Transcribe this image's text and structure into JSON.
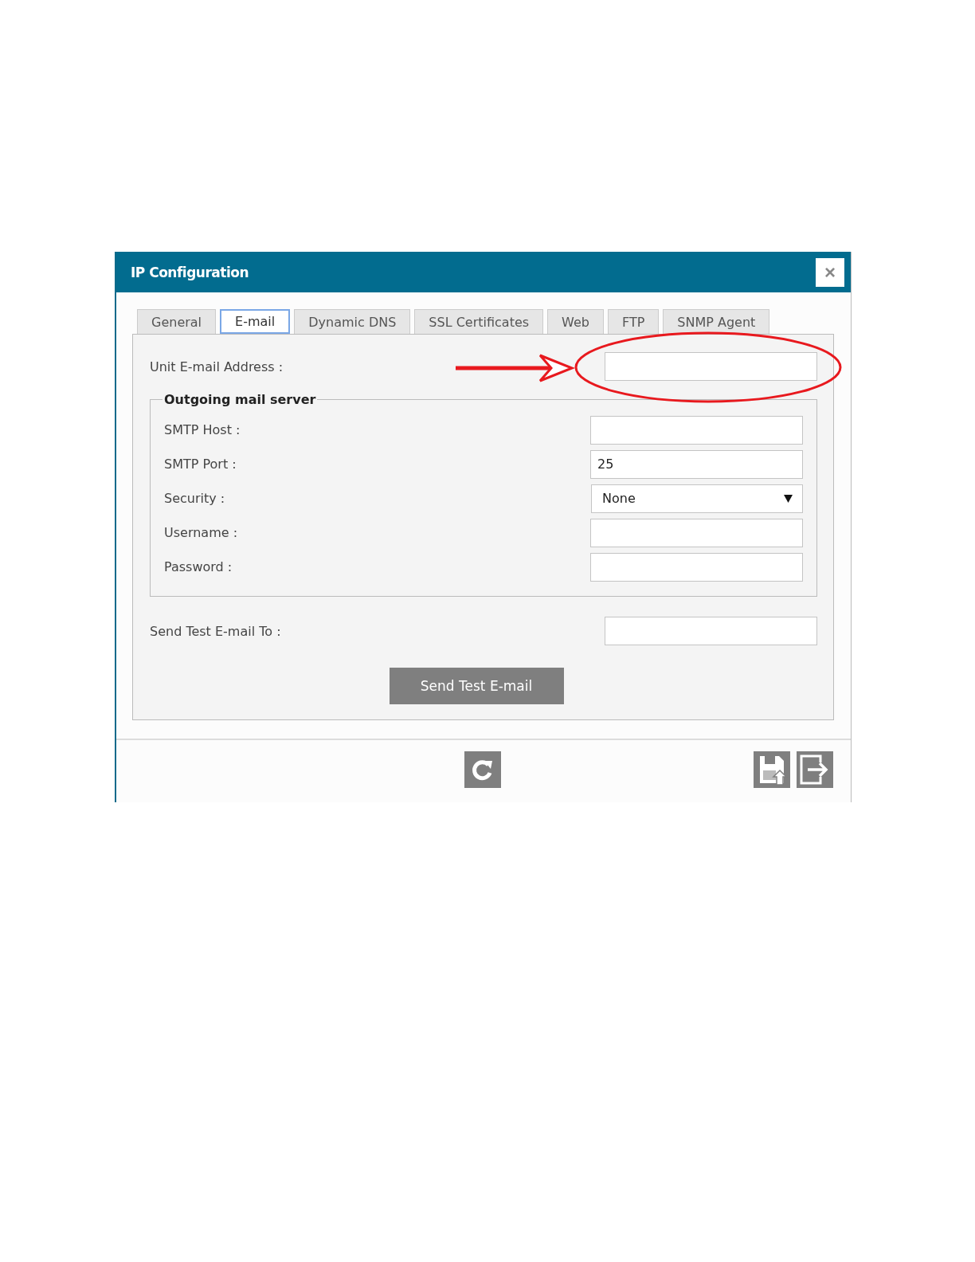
{
  "window": {
    "title": "IP Configuration",
    "close": "×"
  },
  "tabs": [
    {
      "label": "General",
      "selected": false
    },
    {
      "label": "E-mail",
      "selected": true
    },
    {
      "label": "Dynamic DNS",
      "selected": false
    },
    {
      "label": "SSL Certificates",
      "selected": false
    },
    {
      "label": "Web",
      "selected": false
    },
    {
      "label": "FTP",
      "selected": false
    },
    {
      "label": "SNMP Agent",
      "selected": false
    }
  ],
  "unit_email": {
    "label": "Unit E-mail Address :"
  },
  "outgoing": {
    "legend": "Outgoing mail server",
    "fields": [
      {
        "kind": "text",
        "label": "SMTP Host :"
      },
      {
        "kind": "text",
        "label": "SMTP Port :",
        "value": "25"
      },
      {
        "kind": "select",
        "label": "Security :",
        "value": "None"
      },
      {
        "kind": "text",
        "label": "Username :"
      },
      {
        "kind": "password",
        "label": "Password :"
      }
    ]
  },
  "test_email": {
    "label": "Send Test E-mail To :",
    "button": "Send Test E-mail"
  }
}
